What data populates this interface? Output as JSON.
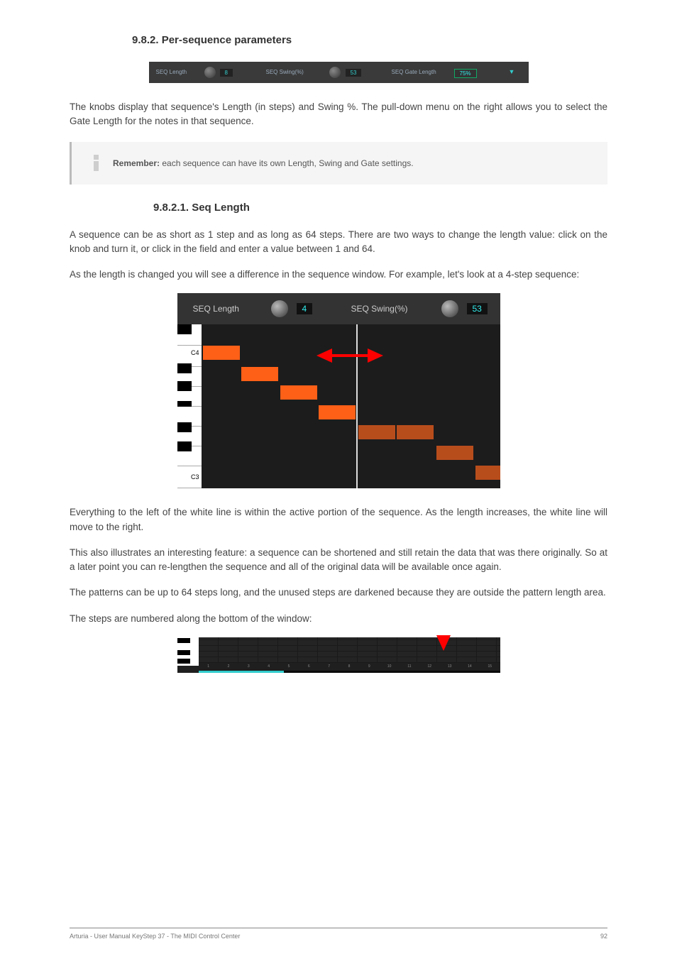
{
  "heading_982": "9.8.2. Per-sequence parameters",
  "img1": {
    "seq_length_lbl": "SEQ Length",
    "seq_length_val": "8",
    "seq_swing_lbl": "SEQ Swing(%)",
    "seq_swing_val": "53",
    "seq_gate_lbl": "SEQ Gate Length",
    "seq_gate_val": "75%"
  },
  "p1": "The knobs display that sequence's Length (in steps) and Swing %. The pull-down menu on the right allows you to select the Gate Length for the notes in that sequence.",
  "callout": {
    "bold": "Remember:",
    "text": " each sequence can have its own Length, Swing and Gate settings."
  },
  "heading_9821": "9.8.2.1. Seq Length",
  "p2": "A sequence can be as short as 1 step and as long as 64 steps. There are two ways to change the length value: click on the knob and turn it, or click in the field and enter a value between 1 and 64.",
  "p3": "As the length is changed you will see a difference in the sequence window. For example, let's look at a 4-step sequence:",
  "img2": {
    "seq_length_lbl": "SEQ Length",
    "seq_length_val": "4",
    "seq_swing_lbl": "SEQ Swing(%)",
    "seq_swing_val": "53",
    "c4": "C4",
    "c3": "C3"
  },
  "p4": "Everything to the left of the white line is within the active portion of the sequence. As the length increases, the white line will move to the right.",
  "p5": "This also illustrates an interesting feature: a sequence can be shortened and still retain the data that was there originally. So at a later point you can re-lengthen the sequence and all of the original data will be available once again.",
  "p6": "The patterns can be up to 64 steps long, and the unused steps are darkened because they are outside the pattern length area.",
  "p7": "The steps are numbered along the bottom of the window:",
  "img3": {
    "nums": [
      "1",
      "2",
      "3",
      "4",
      "5",
      "6",
      "7",
      "8",
      "9",
      "10",
      "11",
      "12",
      "13",
      "14",
      "15"
    ]
  },
  "footer_left": "Arturia - User Manual KeyStep 37 - The MIDI Control Center",
  "footer_right": "92"
}
